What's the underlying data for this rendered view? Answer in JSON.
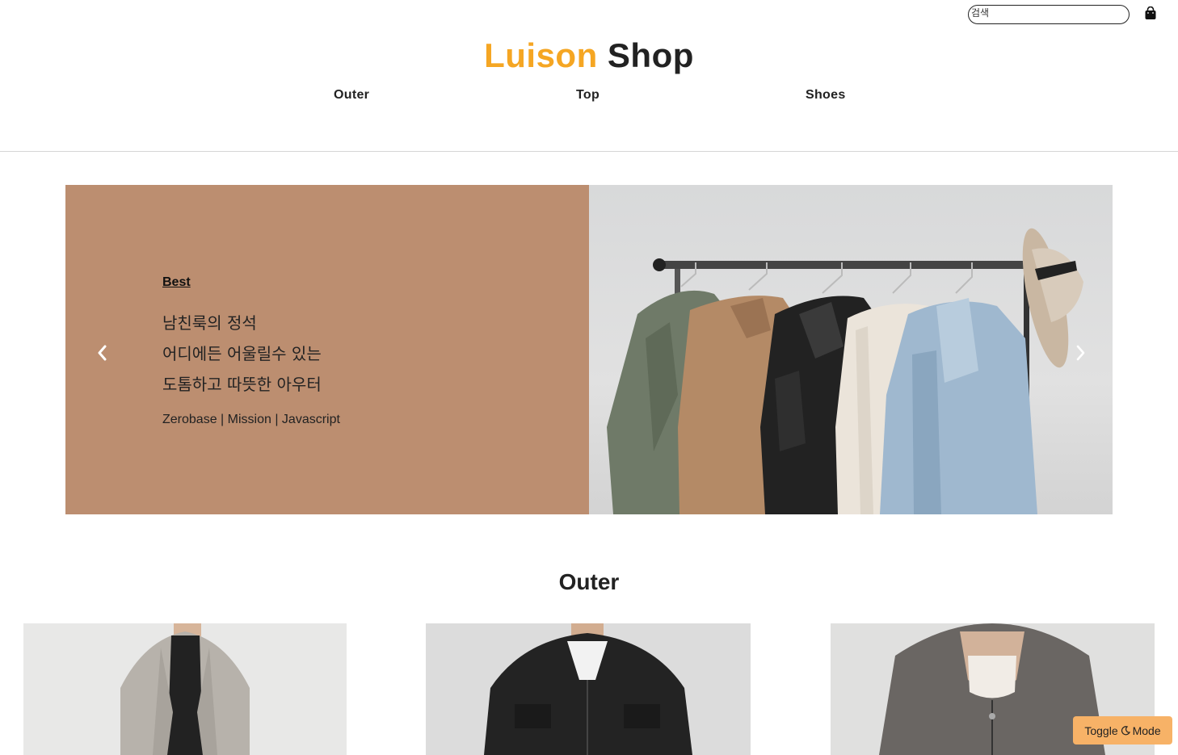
{
  "header": {
    "search_placeholder": "검색",
    "brand_part1": "Luison",
    "brand_part2": "Shop",
    "cart_icon": "shopping-bag-icon",
    "nav": [
      "Outer",
      "Top",
      "Shoes"
    ]
  },
  "hero": {
    "tag": "Best",
    "lines": [
      "남친룩의 정석",
      "어디에든 어울릴수 있는",
      "도톰하고 따뜻한 아우터"
    ],
    "sub": "Zerobase | Mission | Javascript",
    "bg_color": "#bc8e70",
    "prev_icon": "chevron-left-icon",
    "next_icon": "chevron-right-icon"
  },
  "section": {
    "title": "Outer"
  },
  "toggle": {
    "label_before": "Toggle",
    "label_after": "Mode",
    "icon": "moon-icon",
    "color": "#f7b267"
  },
  "colors": {
    "brand_accent": "#f5a623",
    "text": "#222222"
  }
}
